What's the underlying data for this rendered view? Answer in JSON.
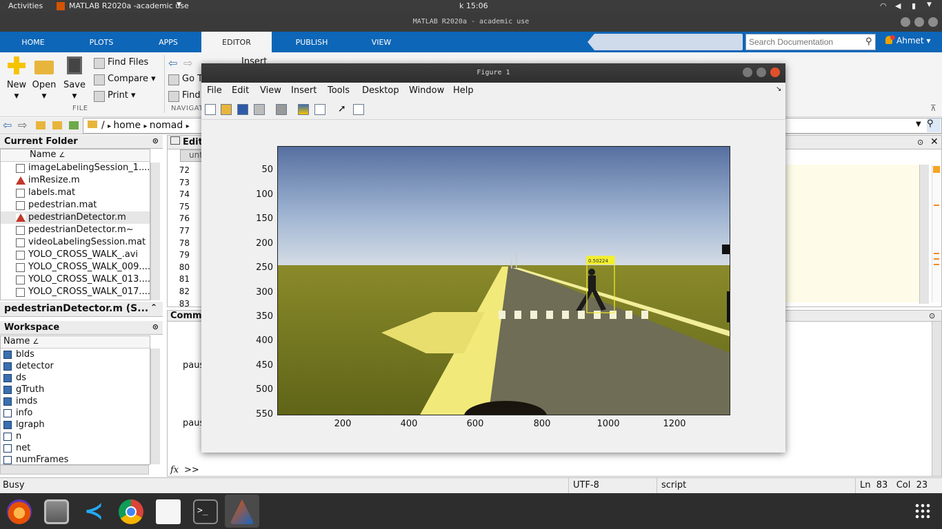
{
  "system": {
    "activities": "Activities",
    "app_name": "MATLAB R2020a -academic use",
    "clock": "k 15:06"
  },
  "window": {
    "title": "MATLAB R2020a - academic use"
  },
  "tabs": [
    {
      "label": "HOME"
    },
    {
      "label": "PLOTS"
    },
    {
      "label": "APPS"
    },
    {
      "label": "EDITOR"
    },
    {
      "label": "PUBLISH"
    },
    {
      "label": "VIEW"
    }
  ],
  "search": {
    "placeholder": "Search Documentation"
  },
  "user": {
    "name": "Ahmet"
  },
  "ribbon": {
    "new": "New",
    "open": "Open",
    "save": "Save",
    "find_files": "Find Files",
    "compare": "Compare",
    "print": "Print",
    "file_group": "FILE",
    "goto": "Go T",
    "find": "Find",
    "nav_group": "NAVIGAT",
    "insert": "Insert"
  },
  "address": {
    "root": "/",
    "home": "home",
    "user": "nomad"
  },
  "current_folder": {
    "title": "Current Folder",
    "col_name": "Name",
    "files": [
      "imageLabelingSession_1....",
      "imResize.m",
      "labels.mat",
      "pedestrian.mat",
      "pedestrianDetector.m",
      "pedestrianDetector.m~",
      "videoLabelingSession.mat",
      "YOLO_CROSS_WALK_.avi",
      "YOLO_CROSS_WALK_009....",
      "YOLO_CROSS_WALK_013....",
      "YOLO_CROSS_WALK_017...."
    ],
    "details": "pedestrianDetector.m  (S..."
  },
  "workspace": {
    "title": "Workspace",
    "col_name": "Name",
    "vars": [
      "blds",
      "detector",
      "ds",
      "gTruth",
      "imds",
      "info",
      "lgraph",
      "n",
      "net",
      "numFrames"
    ]
  },
  "editor": {
    "title": "Edit",
    "tab": "unt",
    "lines": [
      "72",
      "73",
      "74",
      "75",
      "76",
      "77",
      "78",
      "79",
      "80",
      "81",
      "82",
      "83"
    ]
  },
  "command": {
    "title": "Comma",
    "line1": "paus",
    "line2": "paus",
    "prompt": ">>"
  },
  "status": {
    "left": "Busy",
    "encoding": "UTF-8",
    "type": "script",
    "ln_label": "Ln",
    "ln": "83",
    "col_label": "Col",
    "col": "23"
  },
  "figure": {
    "title": "Figure 1",
    "menu": [
      "File",
      "Edit",
      "View",
      "Insert",
      "Tools",
      "Desktop",
      "Window",
      "Help"
    ],
    "yticks": [
      "50",
      "100",
      "150",
      "200",
      "250",
      "300",
      "350",
      "400",
      "450",
      "500",
      "550"
    ],
    "xticks": [
      "200",
      "400",
      "600",
      "800",
      "1000",
      "1200"
    ],
    "detection_score": "0.50224"
  }
}
